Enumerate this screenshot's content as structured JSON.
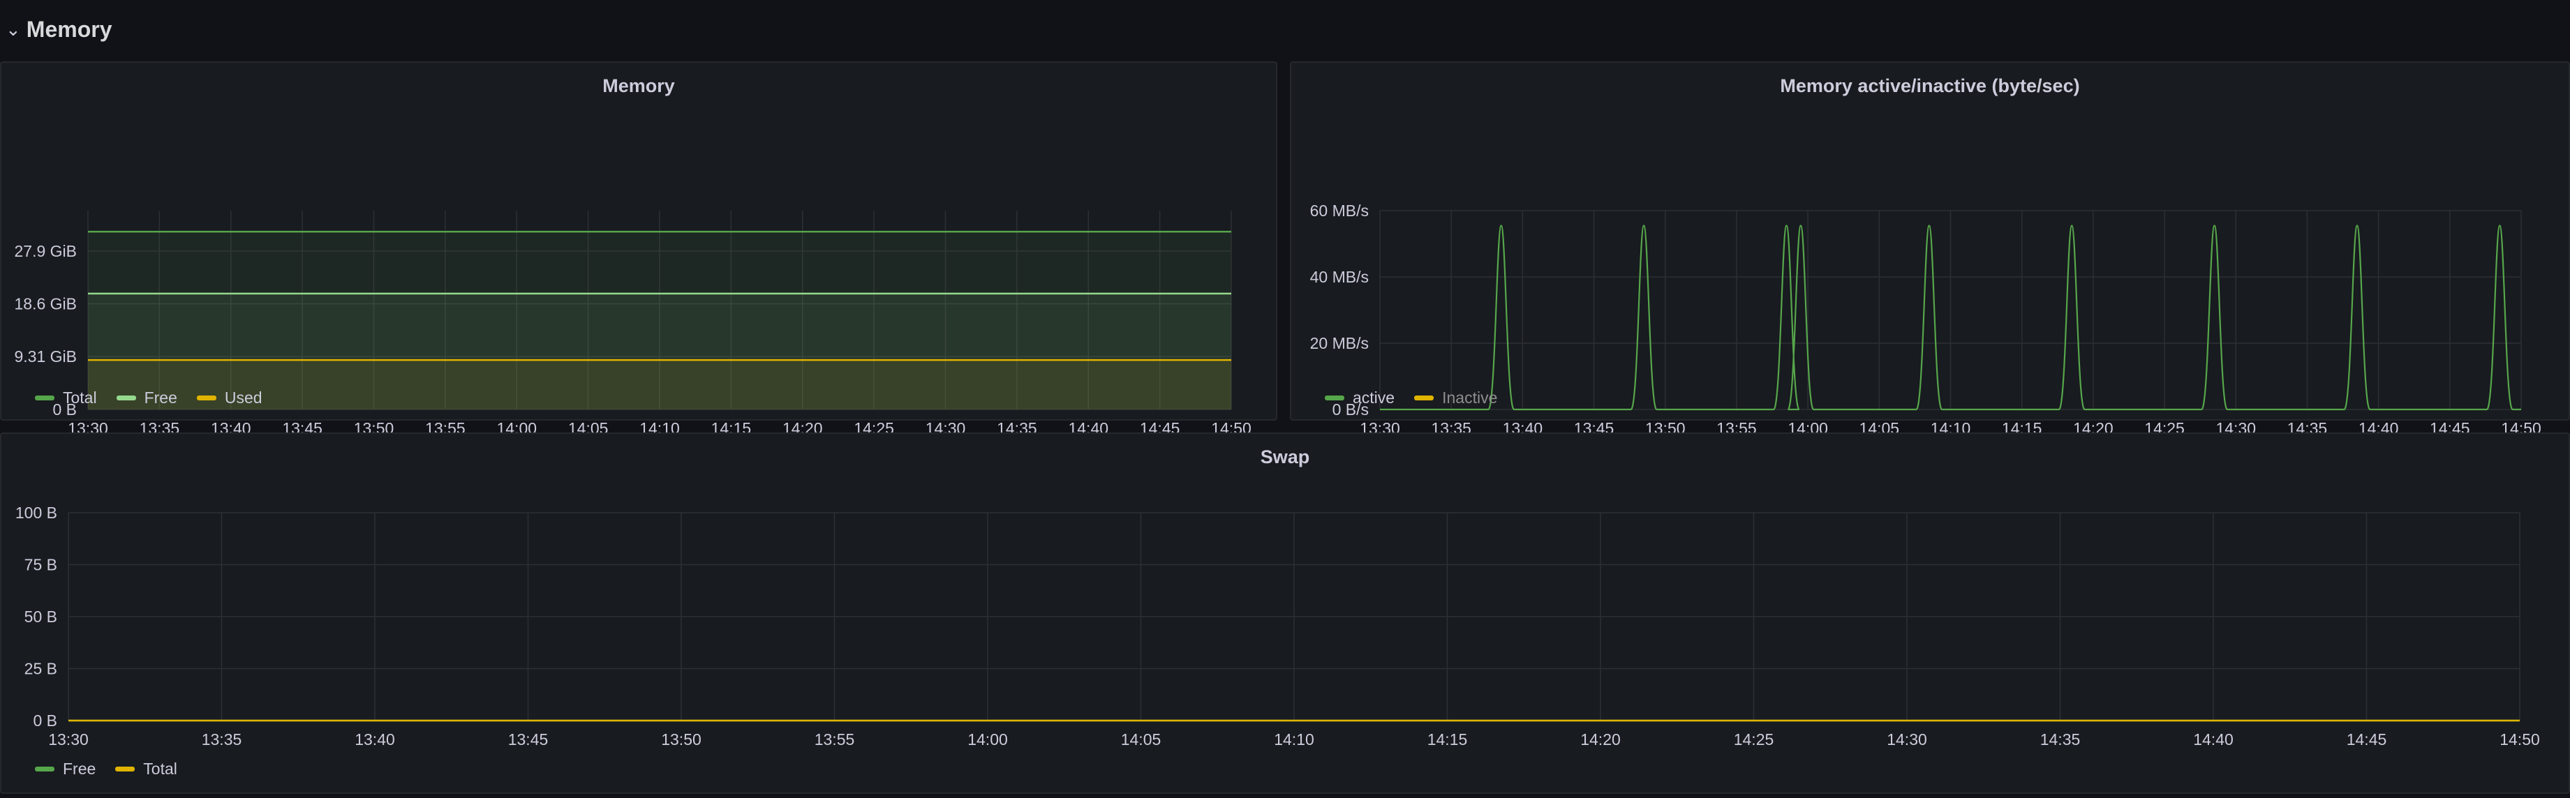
{
  "row": {
    "title": "Memory",
    "chevron_icon": "chevron-down-icon"
  },
  "colors": {
    "green": "#56a64b",
    "light_green": "#96d98d",
    "yellow": "#e0b400",
    "grid": "#2c2f34"
  },
  "panels": [
    {
      "id": "memory",
      "title": "Memory",
      "legend": [
        {
          "label": "Total",
          "color": "#56a64b",
          "dim": false
        },
        {
          "label": "Free",
          "color": "#96d98d",
          "dim": false
        },
        {
          "label": "Used",
          "color": "#e0b400",
          "dim": false
        }
      ]
    },
    {
      "id": "active",
      "title": "Memory active/inactive (byte/sec)",
      "legend": [
        {
          "label": "active",
          "color": "#56a64b",
          "dim": false
        },
        {
          "label": "Inactive",
          "color": "#e0b400",
          "dim": true
        }
      ]
    },
    {
      "id": "swap",
      "title": "Swap",
      "legend": [
        {
          "label": "Free",
          "color": "#56a64b",
          "dim": false
        },
        {
          "label": "Total",
          "color": "#e0b400",
          "dim": false
        }
      ]
    }
  ],
  "chart_data": [
    {
      "type": "area",
      "title": "Memory",
      "x_ticks": [
        "13:30",
        "13:35",
        "13:40",
        "13:45",
        "13:50",
        "13:55",
        "14:00",
        "14:05",
        "14:10",
        "14:15",
        "14:20",
        "14:25",
        "14:30",
        "14:35",
        "14:40",
        "14:45",
        "14:50"
      ],
      "xlim": [
        "13:30",
        "14:50"
      ],
      "y_ticks": [
        {
          "value": 0,
          "label": "0 B"
        },
        {
          "value": 9.31,
          "label": "9.31 GiB"
        },
        {
          "value": 18.6,
          "label": "18.6 GiB"
        },
        {
          "value": 27.9,
          "label": "27.9 GiB"
        }
      ],
      "y_unit": "GiB",
      "ylim": [
        0,
        35
      ],
      "grid": true,
      "legend_position": "bottom-left",
      "series": [
        {
          "name": "Total",
          "color": "#56a64b",
          "fill": true,
          "values": [
            31.3,
            31.3
          ]
        },
        {
          "name": "Free",
          "color": "#96d98d",
          "fill": true,
          "values": [
            20.4,
            20.4
          ]
        },
        {
          "name": "Used",
          "color": "#e0b400",
          "fill": true,
          "values": [
            8.7,
            8.7
          ]
        }
      ]
    },
    {
      "type": "line",
      "title": "Memory active/inactive (byte/sec)",
      "x_ticks": [
        "13:30",
        "13:35",
        "13:40",
        "13:45",
        "13:50",
        "13:55",
        "14:00",
        "14:05",
        "14:10",
        "14:15",
        "14:20",
        "14:25",
        "14:30",
        "14:35",
        "14:40",
        "14:45",
        "14:50"
      ],
      "xlim": [
        "13:30",
        "14:50"
      ],
      "y_ticks": [
        {
          "value": 0,
          "label": "0 B/s"
        },
        {
          "value": 20,
          "label": "20 MB/s"
        },
        {
          "value": 40,
          "label": "40 MB/s"
        },
        {
          "value": 60,
          "label": "60 MB/s"
        }
      ],
      "y_unit": "MB/s",
      "ylim": [
        0,
        60
      ],
      "grid": true,
      "legend_position": "bottom-left",
      "series": [
        {
          "name": "active",
          "color": "#56a64b",
          "baseline": 0,
          "spikes": [
            {
              "t": "13:38:30",
              "value": 55.5
            },
            {
              "t": "13:48:30",
              "value": 55.5
            },
            {
              "t": "13:58:30",
              "value": 55.5
            },
            {
              "t": "13:59:30",
              "value": 55.5
            },
            {
              "t": "14:08:30",
              "value": 55.5
            },
            {
              "t": "14:18:30",
              "value": 55.5
            },
            {
              "t": "14:28:30",
              "value": 55.5
            },
            {
              "t": "14:38:30",
              "value": 55.5
            },
            {
              "t": "14:48:30",
              "value": 55.5
            }
          ]
        },
        {
          "name": "Inactive",
          "color": "#e0b400",
          "hidden": true,
          "values": []
        }
      ]
    },
    {
      "type": "line",
      "title": "Swap",
      "x_ticks": [
        "13:30",
        "13:35",
        "13:40",
        "13:45",
        "13:50",
        "13:55",
        "14:00",
        "14:05",
        "14:10",
        "14:15",
        "14:20",
        "14:25",
        "14:30",
        "14:35",
        "14:40",
        "14:45",
        "14:50"
      ],
      "xlim": [
        "13:30",
        "14:50"
      ],
      "y_ticks": [
        {
          "value": 0,
          "label": "0 B"
        },
        {
          "value": 25,
          "label": "25 B"
        },
        {
          "value": 50,
          "label": "50 B"
        },
        {
          "value": 75,
          "label": "75 B"
        },
        {
          "value": 100,
          "label": "100 B"
        }
      ],
      "y_unit": "B",
      "ylim": [
        0,
        100
      ],
      "grid": true,
      "legend_position": "bottom-left",
      "series": [
        {
          "name": "Free",
          "color": "#56a64b",
          "values": [
            0,
            0
          ]
        },
        {
          "name": "Total",
          "color": "#e0b400",
          "values": [
            0,
            0
          ]
        }
      ]
    }
  ]
}
